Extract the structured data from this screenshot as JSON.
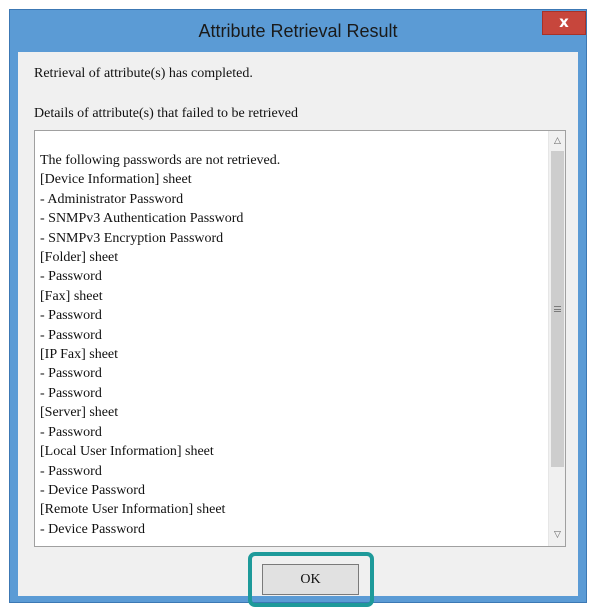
{
  "window": {
    "title": "Attribute Retrieval Result",
    "close_label": "x"
  },
  "messages": {
    "completed": "Retrieval of attribute(s) has completed.",
    "details_label": "Details of attribute(s) that failed to be retrieved"
  },
  "details_lines": [
    "The following passwords are not retrieved.",
    "[Device Information] sheet",
    "- Administrator Password",
    "- SNMPv3 Authentication Password",
    "- SNMPv3 Encryption Password",
    "[Folder] sheet",
    "- Password",
    "[Fax] sheet",
    "- Password",
    "- Password",
    "[IP Fax] sheet",
    "- Password",
    "- Password",
    "[Server] sheet",
    "- Password",
    "[Local User Information] sheet",
    "- Password",
    "- Device Password",
    "[Remote User Information] sheet",
    "- Device Password"
  ],
  "buttons": {
    "ok_label": "OK"
  },
  "colors": {
    "frame": "#5b9bd5",
    "close": "#c7463c",
    "highlight": "#1e9a9a"
  },
  "icons": {
    "scroll_up": "chevron-up-icon",
    "scroll_down": "chevron-down-icon",
    "scroll_grip": "grip-lines-icon"
  }
}
